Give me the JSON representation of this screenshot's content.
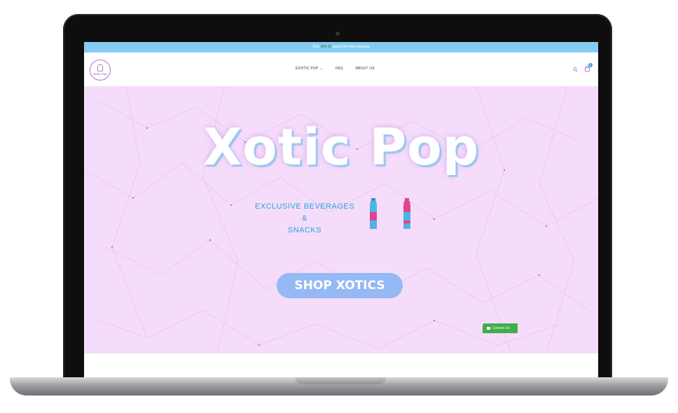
{
  "announcement": {
    "prefix": "Only ",
    "amount": "$40.00",
    "suffix": " away from free shipping"
  },
  "logo": {
    "text": "Xotic Pop"
  },
  "nav": {
    "items": [
      {
        "label": "EXOTIC POP",
        "has_dropdown": true
      },
      {
        "label": "FAQ"
      },
      {
        "label": "ABOUT US"
      }
    ]
  },
  "cart": {
    "count": "0"
  },
  "hero": {
    "title": "Xotic Pop",
    "tagline_line1": "EXCLUSIVE BEVERAGES",
    "tagline_line2": "&",
    "tagline_line3": "SNACKS",
    "cta_label": "SHOP XOTICS"
  },
  "contact": {
    "label": "Contact Us"
  },
  "colors": {
    "announcement_bg": "#86ccf2",
    "hero_bg": "#f6dcfb",
    "cta_bg": "#94b9f4",
    "tagline": "#27a6d8",
    "contact_bg": "#3fae49"
  }
}
